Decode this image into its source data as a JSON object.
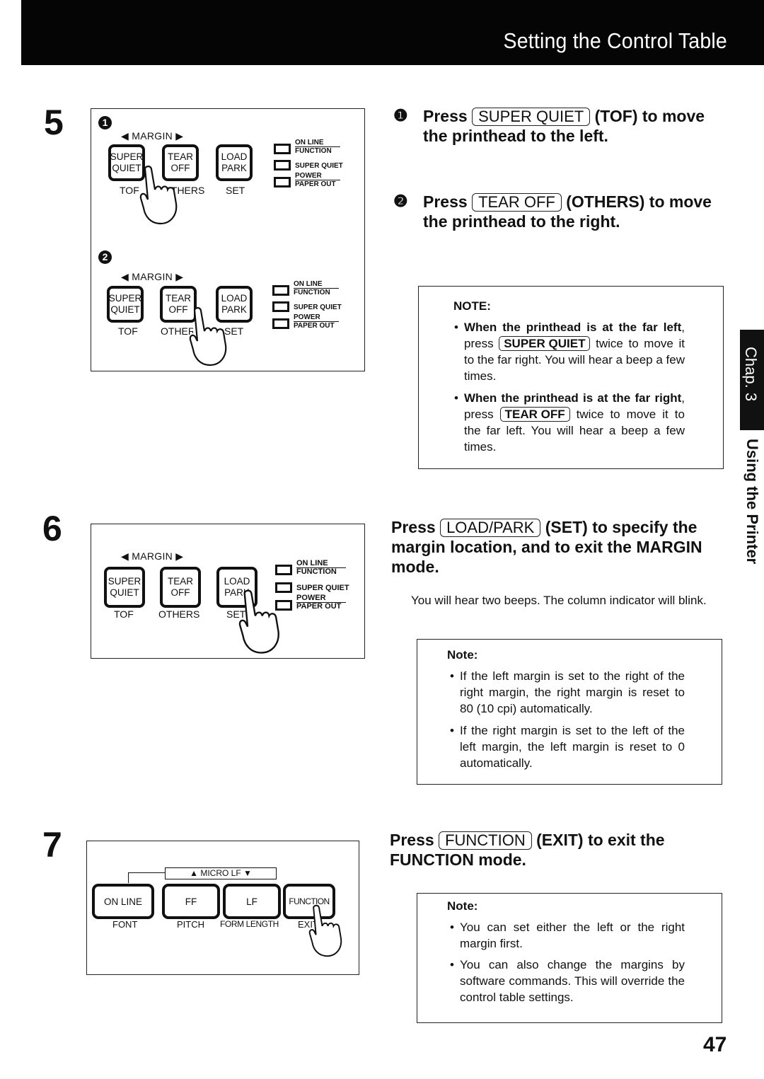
{
  "header": {
    "title": "Setting the Control Table"
  },
  "side_tab": {
    "chapter": "Chap. 3",
    "section": "Using the Printer"
  },
  "page_number": "47",
  "panel_common": {
    "margin_label": "◀ MARGIN ▶",
    "keys": [
      {
        "top": "SUPER",
        "bottom": "QUIET",
        "sub": "TOF"
      },
      {
        "top": "TEAR",
        "bottom": "OFF",
        "sub": "OTHERS"
      },
      {
        "top": "LOAD",
        "bottom": "PARK",
        "sub": "SET"
      }
    ],
    "leds": [
      {
        "top": "ON LINE",
        "bottom": "FUNCTION"
      },
      {
        "top": "",
        "bottom": "SUPER QUIET"
      },
      {
        "top": "POWER",
        "bottom": "PAPER OUT"
      }
    ]
  },
  "step5": {
    "number": "5",
    "panel1_marker": "1",
    "panel2_marker": "2",
    "instructions": [
      {
        "marker": "❶",
        "prefix": "Press",
        "key": "SUPER QUIET",
        "suffix": "(TOF) to move",
        "line2": "the printhead to the left."
      },
      {
        "marker": "❷",
        "prefix": "Press",
        "key": "TEAR OFF",
        "suffix": "(OTHERS) to move",
        "line2": "the printhead to the right."
      }
    ],
    "note": {
      "title": "NOTE:",
      "items": [
        {
          "bold": "When the printhead is at the far left",
          "pre": ", press",
          "key": "SUPER QUIET",
          "post": "twice to move it to the far right. You will hear a beep a few times."
        },
        {
          "bold": "When the printhead is at the far right",
          "pre": ", press",
          "key": "TEAR OFF",
          "post": "twice to move it to the far left. You will hear a beep a few times."
        }
      ]
    }
  },
  "step6": {
    "number": "6",
    "instruction": {
      "prefix": "Press",
      "key": "LOAD/PARK",
      "suffix": "(SET) to specify the",
      "line2": "margin location, and to exit the MARGIN",
      "line3": "mode."
    },
    "body": "You will hear two beeps. The column indicator will blink.",
    "note": {
      "title": "Note:",
      "items": [
        "If the left margin is set to the right of the right margin, the right margin is reset to 80 (10 cpi) automatically.",
        "If the right margin is set to the left of the left margin, the left margin is reset to 0 automatically."
      ]
    }
  },
  "step7": {
    "number": "7",
    "micro_lf": "▲  MICRO LF  ▼",
    "keys": [
      {
        "label": "ON LINE",
        "sub": "FONT"
      },
      {
        "label": "FF",
        "sub": "PITCH"
      },
      {
        "label": "LF",
        "sub": "FORM LENGTH"
      },
      {
        "label": "FUNCTION",
        "sub": "EXIT"
      }
    ],
    "instruction": {
      "prefix": "Press",
      "key": "FUNCTION",
      "suffix": "(EXIT) to exit the",
      "line2": "FUNCTION mode."
    },
    "note": {
      "title": "Note:",
      "items": [
        "You can set either the left or the right margin first.",
        "You can also change the margins by software commands. This will override the control table settings."
      ]
    }
  }
}
